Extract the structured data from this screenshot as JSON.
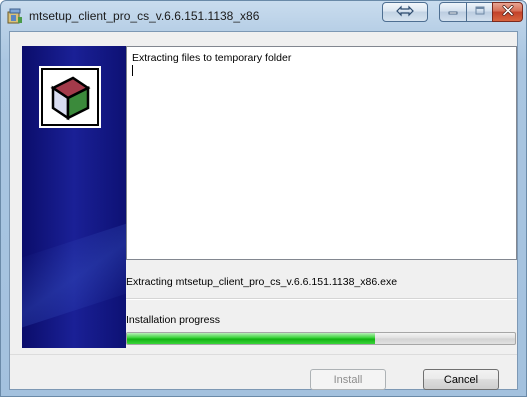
{
  "window": {
    "title": "mtsetup_client_pro_cs_v.6.6.151.1138_x86"
  },
  "log": {
    "lines": [
      "Extracting files to temporary folder"
    ]
  },
  "status": {
    "current_file": "Extracting mtsetup_client_pro_cs_v.6.6.151.1138_x86.exe"
  },
  "progress": {
    "label": "Installation progress",
    "fraction": 0.64
  },
  "buttons": {
    "install_label": "Install",
    "cancel_label": "Cancel"
  },
  "icons": {
    "app": "installer-icon",
    "logo": "box-logo-icon",
    "restore": "restore-icon",
    "minimize": "minimize-icon",
    "maximize": "maximize-icon",
    "close": "close-icon"
  },
  "colors": {
    "progress_fill": "#1fc41f",
    "side_panel": "#141a88",
    "close_button": "#c9442b"
  }
}
